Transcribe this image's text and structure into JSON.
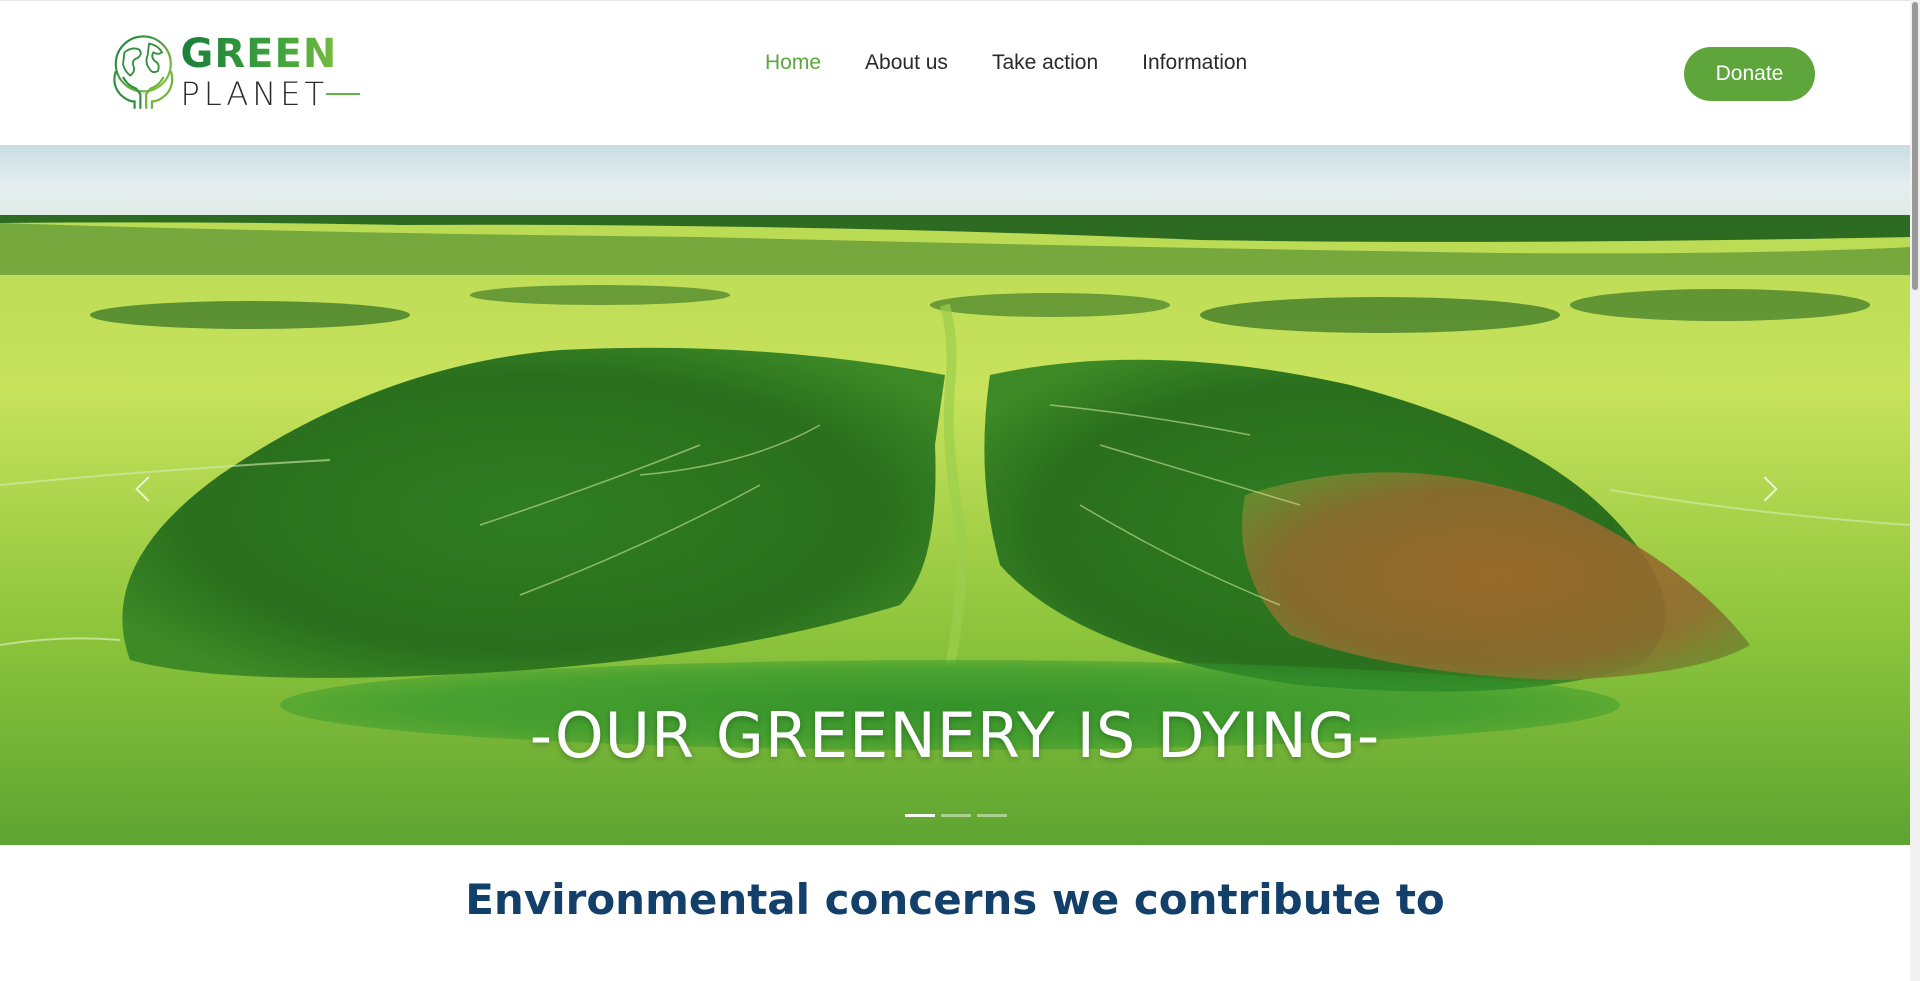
{
  "brand": {
    "line1": "GREEN",
    "line2": "PLANET"
  },
  "nav": {
    "items": [
      "Home",
      "About us",
      "Take action",
      "Information"
    ],
    "active": "Home"
  },
  "donate_label": "Donate",
  "hero": {
    "caption": "-OUR GREENERY IS DYING-",
    "slide_count": 3,
    "active_slide": 1
  },
  "section": {
    "title": "Environmental concerns we contribute to"
  },
  "colors": {
    "accent": "#5ea63c",
    "heading": "#12406b",
    "nav_text": "#2a2a2a"
  },
  "icons": [
    "globe-hands-logo-icon",
    "chevron-left-icon",
    "chevron-right-icon"
  ]
}
